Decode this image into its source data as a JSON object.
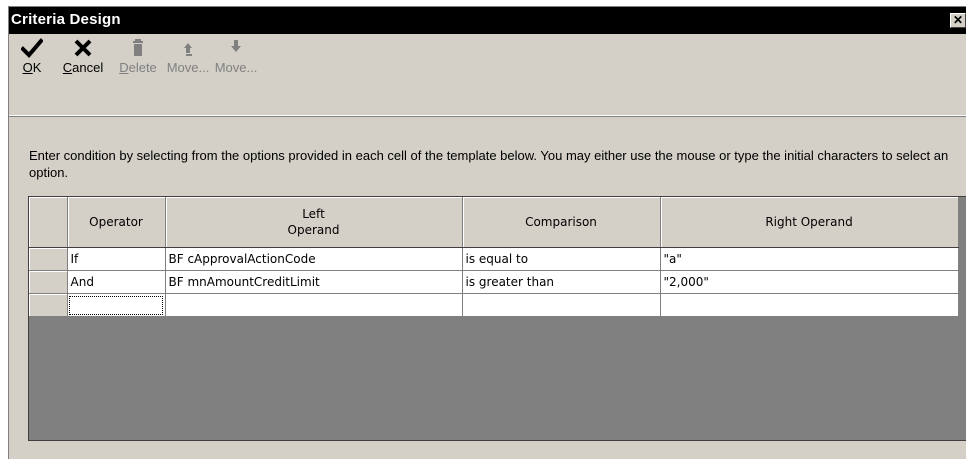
{
  "window": {
    "title": "Criteria Design",
    "close_glyph": "✕"
  },
  "toolbar": {
    "ok": {
      "label": "OK",
      "mnemonic": "O",
      "rest": "K",
      "icon": "checkmark-icon",
      "enabled": true
    },
    "cancel": {
      "label": "Cancel",
      "mnemonic": "C",
      "rest": "ancel",
      "icon": "x-icon",
      "enabled": true
    },
    "delete": {
      "label": "Delete",
      "mnemonic": "D",
      "rest": "elete",
      "icon": "trash-icon",
      "enabled": false
    },
    "move_up": {
      "label": "Move...",
      "icon": "arrow-up-icon",
      "enabled": false
    },
    "move_down": {
      "label": "Move...",
      "icon": "arrow-down-icon",
      "enabled": false
    }
  },
  "instructions": "Enter condition by selecting from the options provided in each cell of the template below. You may either use the mouse or type the initial characters to select an option.",
  "grid": {
    "headers": {
      "operator": "Operator",
      "left_line1": "Left",
      "left_line2": "Operand",
      "comparison": "Comparison",
      "right": "Right Operand"
    },
    "rows": [
      {
        "operator": "If",
        "left": "BF cApprovalActionCode",
        "comparison": "is equal to",
        "right": "\"a\""
      },
      {
        "operator": "And",
        "left": "BF mnAmountCreditLimit",
        "comparison": "is greater than",
        "right": "\"2,000\""
      },
      {
        "operator": "",
        "left": "",
        "comparison": "",
        "right": ""
      }
    ]
  },
  "colors": {
    "titlebar": "#000000",
    "window_bg": "#d4d0c8",
    "grid_empty": "#808080"
  }
}
